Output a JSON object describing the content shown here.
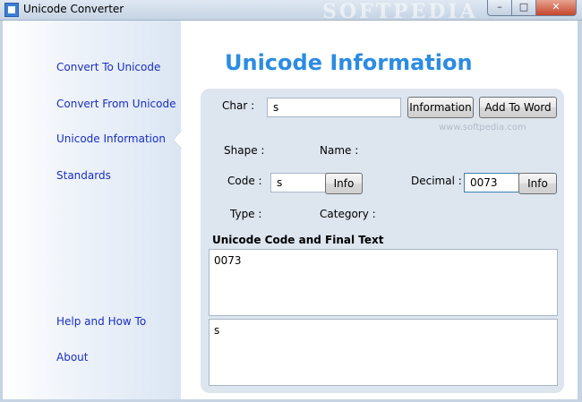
{
  "window": {
    "title": "Unicode Converter",
    "watermark": "SOFTPEDIA",
    "minimize_glyph": "–",
    "maximize_glyph": "□",
    "close_glyph": "✕"
  },
  "sidebar": {
    "items": [
      {
        "label": "Convert To Unicode"
      },
      {
        "label": "Convert From Unicode"
      },
      {
        "label": "Unicode Information"
      },
      {
        "label": "Standards"
      },
      {
        "label": "Help and How To"
      },
      {
        "label": "About"
      }
    ],
    "selected_index": 2
  },
  "main": {
    "title": "Unicode Information",
    "char_label": "Char :",
    "char_value": "s",
    "information_button": "Information",
    "add_to_word_button": "Add To Word",
    "watermark_small": "www.softpedia.com",
    "shape_label": "Shape :",
    "name_label": "Name :",
    "code_label": "Code :",
    "code_value": "s",
    "code_info_button": "Info",
    "decimal_label": "Decimal :",
    "decimal_value": "0073",
    "decimal_info_button": "Info",
    "type_label": "Type :",
    "category_label": "Category :",
    "section_heading": "Unicode Code and Final Text",
    "code_text": "0073",
    "final_text": "s"
  },
  "colors": {
    "accent_title": "#2c8ce2",
    "nav_link": "#1a2ec2",
    "panel_bg": "#dde5ef"
  }
}
